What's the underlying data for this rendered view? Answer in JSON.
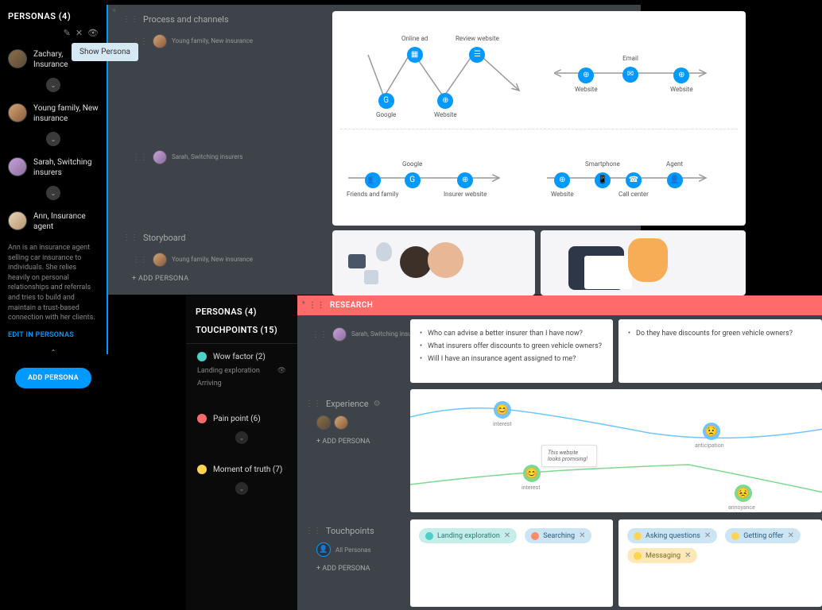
{
  "panel1": {
    "title": "PERSONAS (4)",
    "tooltip": "Show Persona",
    "personas": [
      {
        "name": "Zachary, Insurance"
      },
      {
        "name": "Young family, New insurance"
      },
      {
        "name": "Sarah, Switching insurers"
      },
      {
        "name": "Ann, Insurance agent"
      }
    ],
    "ann_desc": "Ann is an insurance agent selling car insurance to individuals. She relies heavily on personal relationships and referrals and tries to build and maintain a trust-based connection with her clients.",
    "edit_link": "EDIT IN PERSONAS",
    "add_btn": "ADD PERSONA"
  },
  "sections": {
    "process": "Process and channels",
    "storyboard": "Storyboard",
    "experience": "Experience",
    "touchpoints": "Touchpoints",
    "research": "RESEARCH"
  },
  "mini_personas": {
    "young": "Young family, New insurance",
    "sarah": "Sarah, Switching insurers",
    "all": "All Personas"
  },
  "add_persona_text": "+ ADD PERSONA",
  "journey": {
    "row1": {
      "google": "Google",
      "online_ad": "Online ad",
      "website": "Website",
      "review": "Review website",
      "email": "Email",
      "website_l": "Website",
      "website_r": "Website"
    },
    "row2": {
      "friends": "Friends and family",
      "google": "Google",
      "insurer": "Insurer website",
      "website": "Website",
      "smartphone": "Smartphone",
      "callcenter": "Call center",
      "agent": "Agent"
    }
  },
  "panel2": {
    "title": "PERSONAS (4)",
    "subtitle": "TOUCHPOINTS (15)",
    "wow": "Wow factor (2)",
    "landing": "Landing exploration",
    "arriving": "Arriving",
    "pain": "Pain point (6)",
    "moment": "Moment of truth (7)"
  },
  "research": {
    "q1": "Who can advise a better insurer than I have now?",
    "q2": "What insurers offer discounts to green vehicle owners?",
    "q3": "Will I have an insurance agent assigned to me?",
    "q4": "Do they have discounts for green vehicle owners?"
  },
  "experience": {
    "interest": "interest",
    "anticipation": "anticipation",
    "annoyance": "annoyance",
    "note": "This website looks promising!"
  },
  "chips": {
    "landing": "Landing exploration",
    "searching": "Searching",
    "asking": "Asking questions",
    "getting": "Getting offer",
    "messaging": "Messaging"
  }
}
